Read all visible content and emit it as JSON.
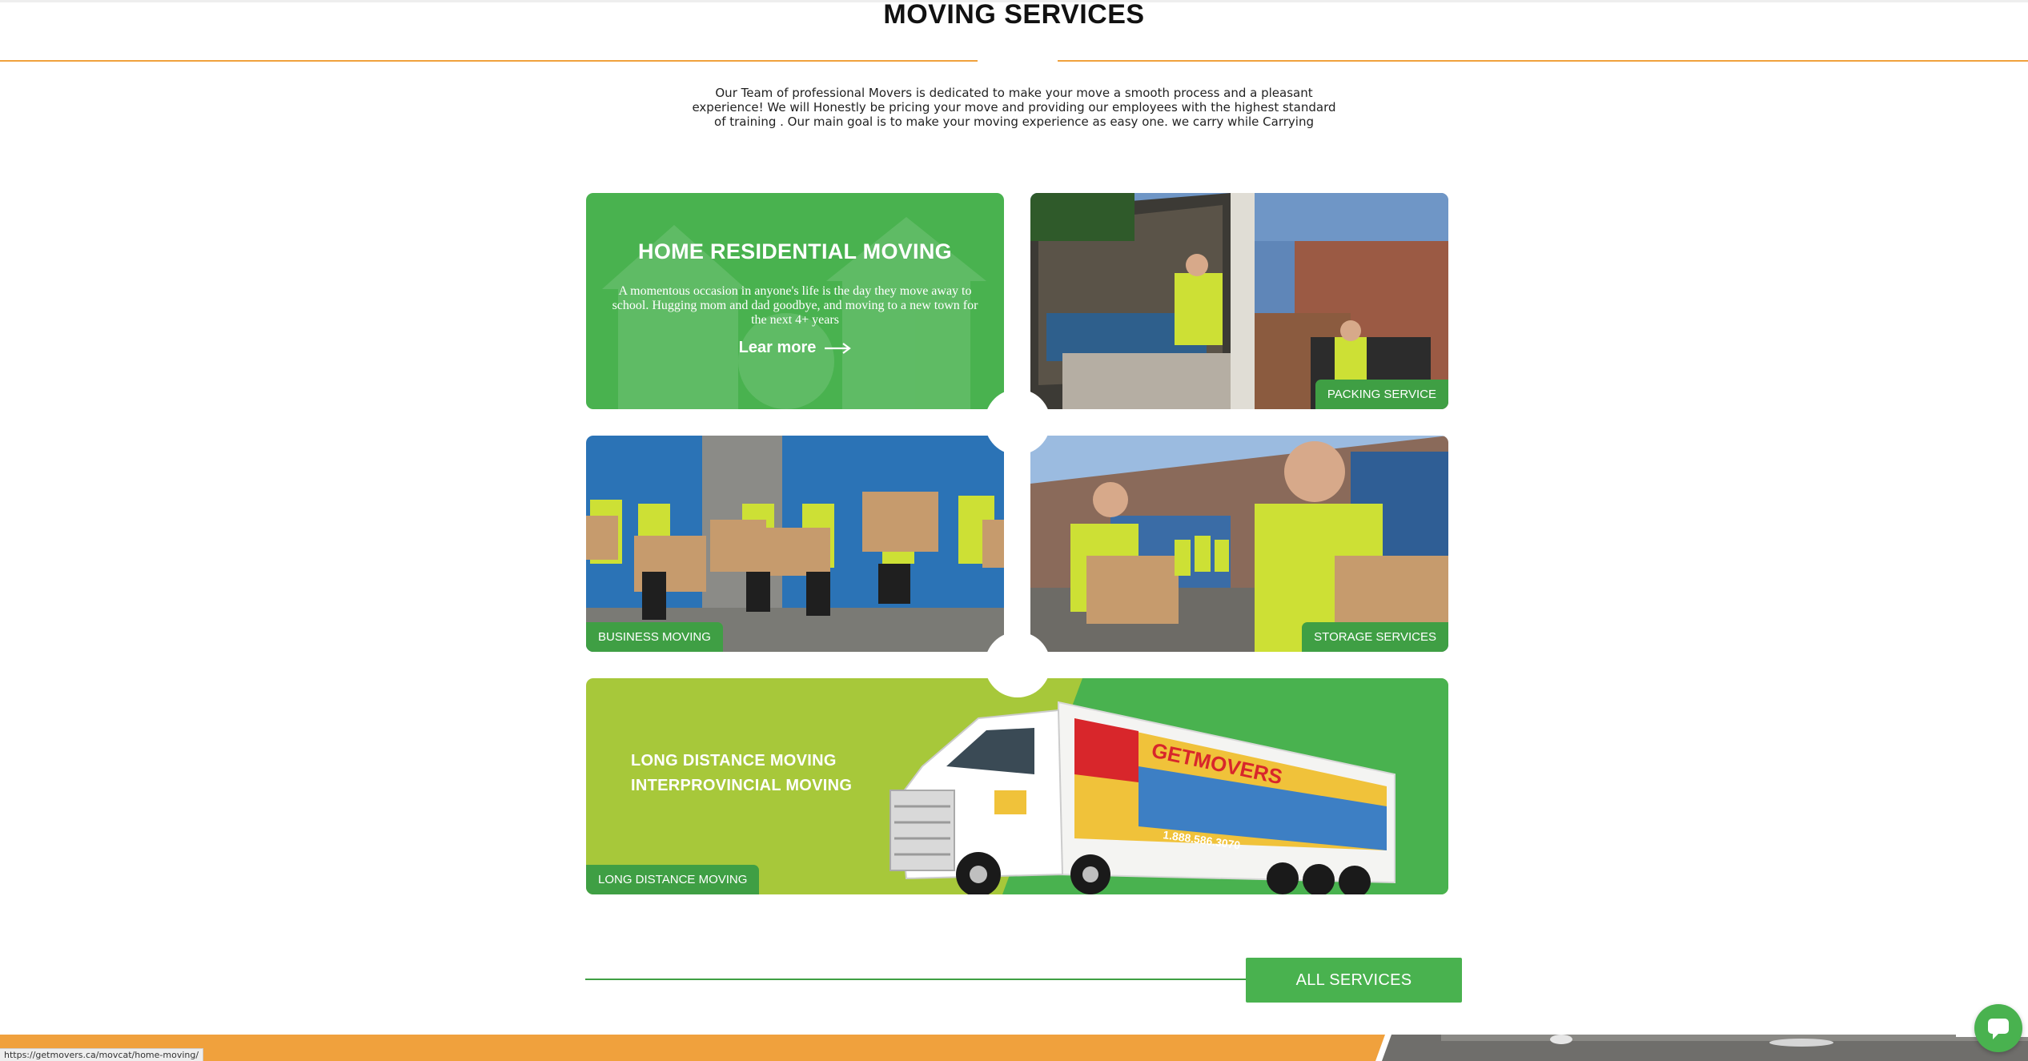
{
  "colors": {
    "brand_green": "#49b24f",
    "dark_green": "#3f9f44",
    "lime_green": "#a7c83a",
    "accent_orange": "#f0a13d"
  },
  "section": {
    "title": "MOVING SERVICES",
    "intro": "Our Team of professional Movers is dedicated to make your move a smooth process and a pleasant experience! We will Honestly be pricing your move and providing our employees with the highest standard of training . Our main goal is to make your moving experience as easy one. we carry while Carrying"
  },
  "cards": {
    "home": {
      "title": "HOME RESIDENTIAL MOVING",
      "description": "A momentous occasion in anyone's life is the day they move away to school. Hugging mom and dad goodbye, and moving to a new town for the next 4+ years",
      "link_label": "Lear more"
    },
    "packing": {
      "tag": "PACKING SERVICE"
    },
    "business": {
      "tag": "BUSINESS MOVING"
    },
    "storage": {
      "tag": "STORAGE SERVICES"
    },
    "long_distance": {
      "line1": "LONG DISTANCE MOVING",
      "line2": "INTERPROVINCIAL MOVING",
      "tag": "LONG DISTANCE MOVING",
      "truck_brand": "GETMOVERS",
      "truck_phone": "1.888.586.3070"
    }
  },
  "footer_actions": {
    "all_services_label": "ALL SERVICES"
  },
  "browser": {
    "status_url": "https://getmovers.ca/movcat/home-moving/"
  },
  "icons": {
    "learn_more": "arrow-right-icon",
    "chat": "chat-bubble-icon"
  }
}
